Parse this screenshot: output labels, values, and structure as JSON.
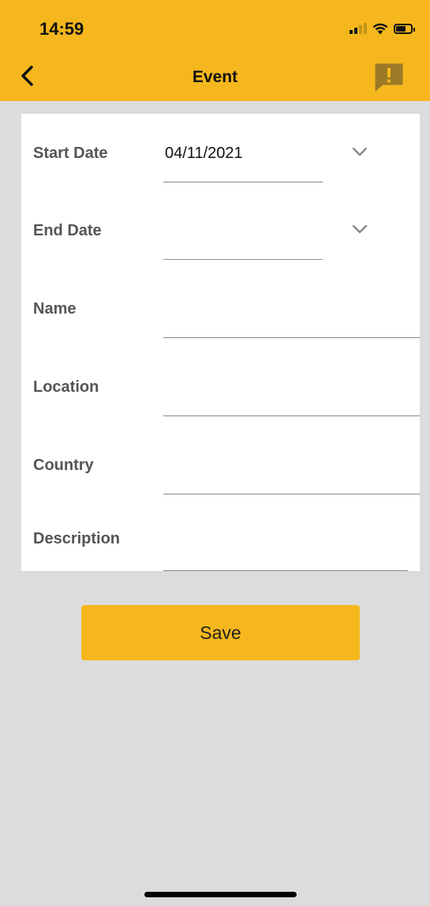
{
  "status_bar": {
    "time": "14:59",
    "icons": [
      "signal-icon",
      "wifi-icon",
      "battery-icon"
    ]
  },
  "nav": {
    "title": "Event",
    "back_icon": "chevron-left-icon",
    "report_icon": "report-icon"
  },
  "form": {
    "fields": [
      {
        "label": "Start Date",
        "value": "04/11/2021",
        "type": "dropdown"
      },
      {
        "label": "End Date",
        "value": "",
        "type": "dropdown"
      },
      {
        "label": "Name",
        "value": "",
        "type": "text"
      },
      {
        "label": "Location",
        "value": "",
        "type": "text"
      },
      {
        "label": "Country",
        "value": "",
        "type": "text"
      },
      {
        "label": "Description",
        "value": "",
        "type": "text"
      }
    ]
  },
  "actions": {
    "save_label": "Save"
  },
  "colors": {
    "accent": "#f5b71d",
    "background": "#dcdcdc",
    "card": "#ffffff"
  }
}
